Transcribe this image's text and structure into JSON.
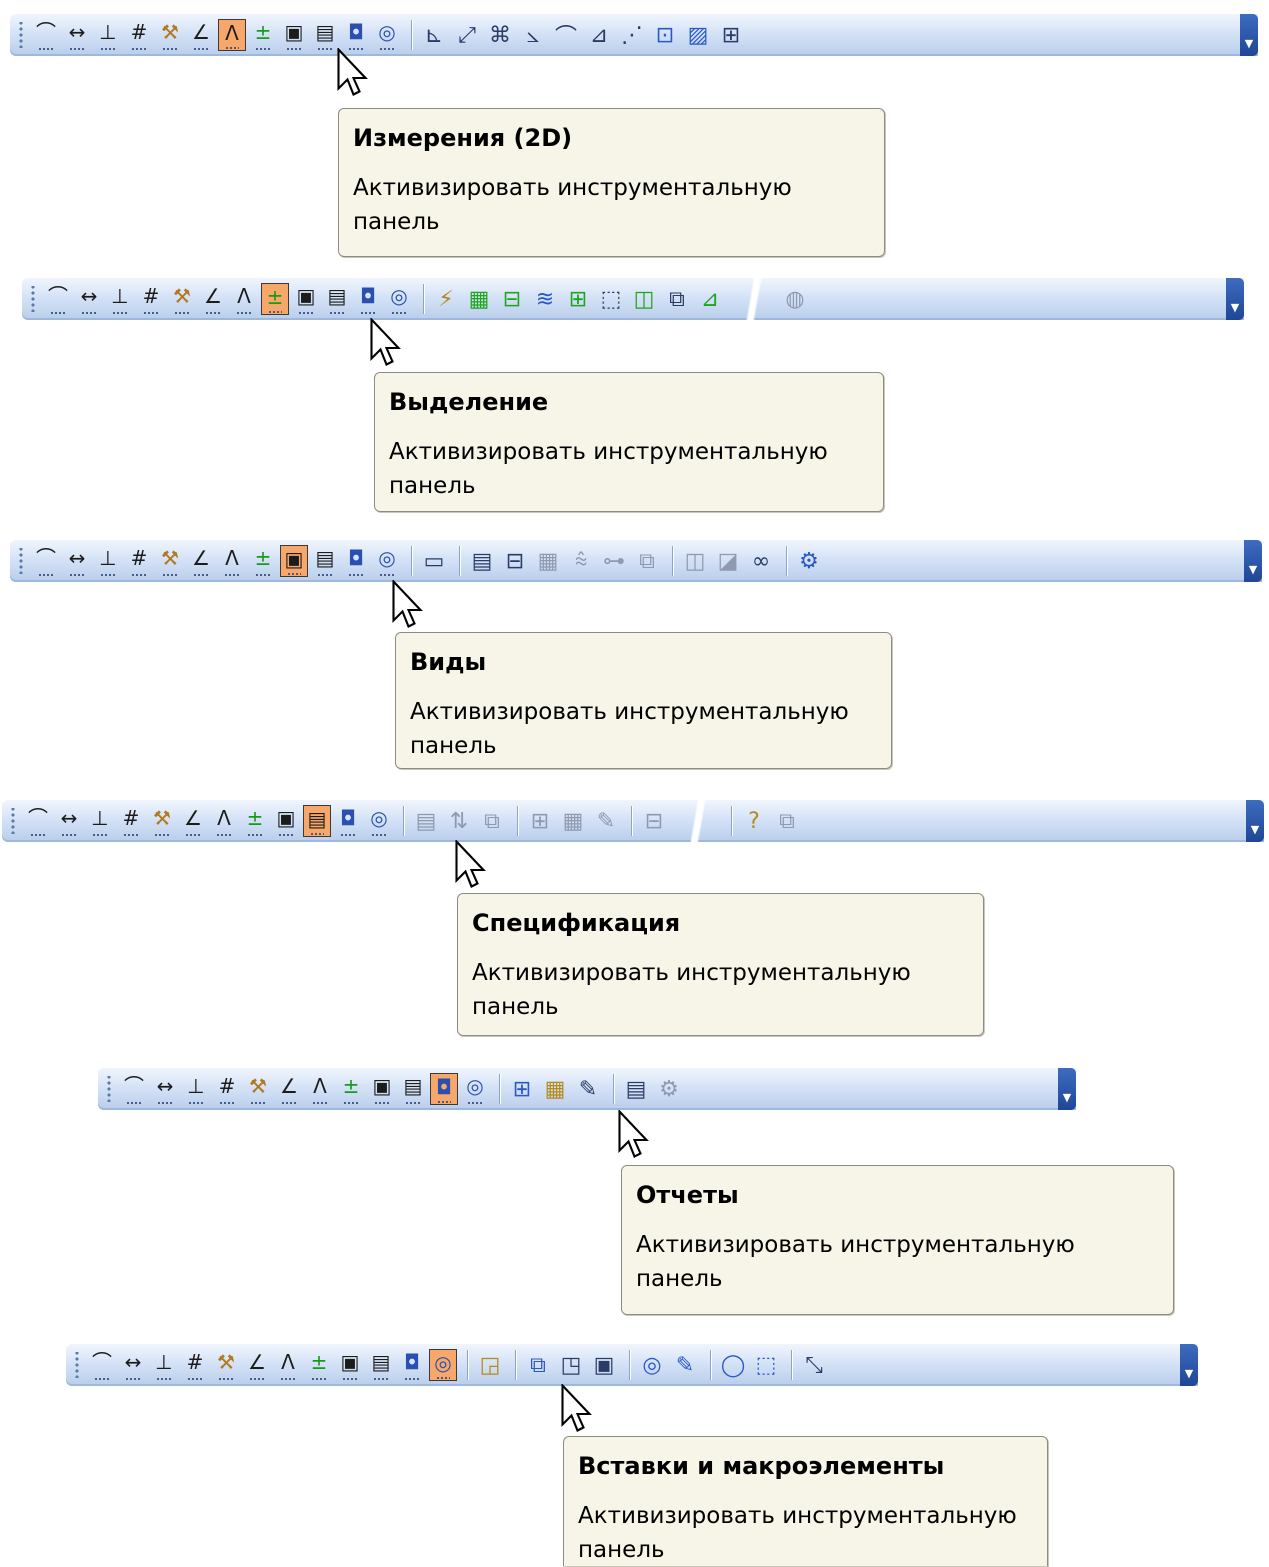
{
  "tool_groups": [
    {
      "active_index": 6,
      "right_icons": [
        "dimension-linear-icon",
        "dimension-aligned-icon",
        "dimension-radial-icon",
        "dimension-angular-icon",
        "dimension-arc-icon",
        "dimension-chain-icon",
        "dimension-baseline-icon",
        "dimension-region-icon",
        "dimension-hatch-icon",
        "dimension-table-icon"
      ],
      "tooltip": {
        "title": "Измерения (2D)",
        "description": "Активизировать инструментальную панель"
      }
    },
    {
      "active_index": 7,
      "right_icons": [
        "select-by-type-icon",
        "select-all-icon",
        "select-frame-icon",
        "select-layer-icon",
        "select-view-icon",
        "select-window-icon",
        "select-crossing-icon",
        "select-group-icon",
        "select-polyline-icon",
        "select-extra-icon"
      ],
      "tooltip": {
        "title": "Выделение",
        "description": "Активизировать инструментальную панель"
      }
    },
    {
      "active_index": 8,
      "right_icons": [
        "new-view-icon",
        "view-projection-icon",
        "view-arrow-icon",
        "view-section-icon",
        "view-detail-icon",
        "view-break-icon",
        "view-local-icon",
        "view-rotate-icon",
        "view-cut-icon",
        "view-scale-icon",
        "view-manager-icon"
      ],
      "tooltip": {
        "title": "Виды",
        "description": "Активизировать инструментальную панель"
      }
    },
    {
      "active_index": 9,
      "right_icons": [
        "spec-sheet-icon",
        "spec-sort-icon",
        "spec-attach-icon",
        "spec-object-icon",
        "spec-table-icon",
        "spec-edit-icon",
        "spec-bom-icon",
        "spec-help-icon",
        "spec-export-icon"
      ],
      "tooltip": {
        "title": "Спецификация",
        "description": "Активизировать инструментальную панель"
      }
    },
    {
      "active_index": 10,
      "right_icons": [
        "report-create-icon",
        "report-open-icon",
        "report-edit-icon",
        "report-document-icon",
        "report-settings-icon"
      ],
      "tooltip": {
        "title": "Отчеты",
        "description": "Активизировать инструментальную панель"
      }
    },
    {
      "active_index": 11,
      "right_icons": [
        "insert-view-icon",
        "insert-fragment-icon",
        "insert-local-fragment-icon",
        "insert-picture-icon",
        "macro-create-icon",
        "macro-edit-icon",
        "insert-raster-icon",
        "insert-ole-icon",
        "insert-arrow-icon"
      ],
      "tooltip": {
        "title": "Вставки и макроэлементы",
        "description": "Активизировать инструментальную панель"
      }
    }
  ]
}
